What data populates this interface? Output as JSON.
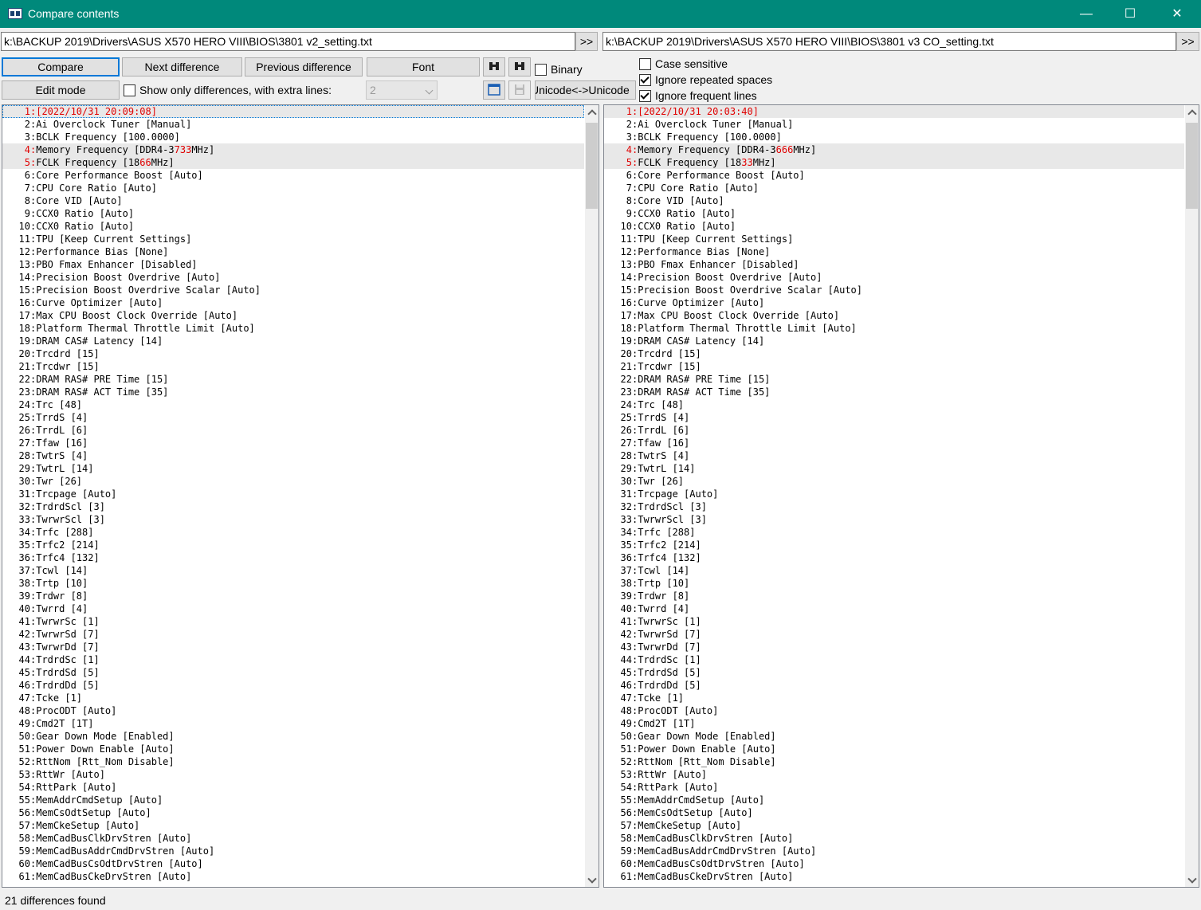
{
  "window": {
    "title": "Compare contents",
    "minimize": "—",
    "maximize": "☐",
    "close": "✕"
  },
  "left_path": "k:\\BACKUP 2019\\Drivers\\ASUS X570 HERO VIII\\BIOS\\3801 v2_setting.txt",
  "right_path": "k:\\BACKUP 2019\\Drivers\\ASUS X570 HERO VIII\\BIOS\\3801 v3 CO_setting.txt",
  "toolbar": {
    "browse_label": ">>",
    "compare": "Compare",
    "next_difference": "Next difference",
    "previous_difference": "Previous difference",
    "font": "Font",
    "binary": "Binary",
    "edit_mode": "Edit mode",
    "show_only_differences": "Show only differences, with extra lines:",
    "extra_lines_value": "2",
    "unicode": "Unicode<->Unicode",
    "case_sensitive": "Case sensitive",
    "ignore_repeated_spaces": "Ignore repeated spaces",
    "ignore_frequent_lines": "Ignore frequent lines"
  },
  "options_state": {
    "binary": false,
    "show_only_differences": false,
    "case_sensitive": false,
    "ignore_repeated_spaces": true,
    "ignore_frequent_lines": true
  },
  "icons": [
    "binoculars-icon",
    "binoculars-back-icon",
    "window-icon",
    "save-icon",
    "app-compare-icon"
  ],
  "colors": {
    "titlebar": "#00897b",
    "diff_text": "#e00000",
    "diff_row": "#e8e8e8"
  },
  "left_lines": [
    {
      "n": "1",
      "t": "[2022/10/31 20:09:08]",
      "d": true,
      "parts": [
        {
          "t": "[2022/10/31 20:",
          "h": true
        },
        {
          "t": "09",
          "h": true
        },
        {
          "t": ":08]",
          "h": true
        }
      ]
    },
    {
      "n": "2",
      "t": "Ai Overclock Tuner [Manual]"
    },
    {
      "n": "3",
      "t": "BCLK Frequency [100.0000]"
    },
    {
      "n": "4",
      "t": "Memory Frequency [DDR4-3733MHz]",
      "d": true,
      "parts": [
        {
          "t": "Memory Frequency [DDR4-3"
        },
        {
          "t": "733",
          "h": true
        },
        {
          "t": "MHz]"
        }
      ]
    },
    {
      "n": "5",
      "t": "FCLK Frequency [1866MHz]",
      "d": true,
      "parts": [
        {
          "t": "FCLK Frequency [18"
        },
        {
          "t": "66",
          "h": true
        },
        {
          "t": "MHz]"
        }
      ]
    },
    {
      "n": "6",
      "t": "Core Performance Boost [Auto]"
    },
    {
      "n": "7",
      "t": "CPU Core Ratio [Auto]"
    },
    {
      "n": "8",
      "t": "Core VID [Auto]"
    },
    {
      "n": "9",
      "t": "CCX0 Ratio [Auto]"
    },
    {
      "n": "10",
      "t": "CCX0 Ratio [Auto]"
    },
    {
      "n": "11",
      "t": "TPU [Keep Current Settings]"
    },
    {
      "n": "12",
      "t": "Performance Bias [None]"
    },
    {
      "n": "13",
      "t": "PBO Fmax Enhancer [Disabled]"
    },
    {
      "n": "14",
      "t": "Precision Boost Overdrive [Auto]"
    },
    {
      "n": "15",
      "t": "Precision Boost Overdrive Scalar [Auto]"
    },
    {
      "n": "16",
      "t": "Curve Optimizer [Auto]"
    },
    {
      "n": "17",
      "t": "Max CPU Boost Clock Override [Auto]"
    },
    {
      "n": "18",
      "t": "Platform Thermal Throttle Limit [Auto]"
    },
    {
      "n": "19",
      "t": "DRAM CAS# Latency [14]"
    },
    {
      "n": "20",
      "t": "Trcdrd [15]"
    },
    {
      "n": "21",
      "t": "Trcdwr [15]"
    },
    {
      "n": "22",
      "t": "DRAM RAS# PRE Time [15]"
    },
    {
      "n": "23",
      "t": "DRAM RAS# ACT Time [35]"
    },
    {
      "n": "24",
      "t": "Trc [48]"
    },
    {
      "n": "25",
      "t": "TrrdS [4]"
    },
    {
      "n": "26",
      "t": "TrrdL [6]"
    },
    {
      "n": "27",
      "t": "Tfaw [16]"
    },
    {
      "n": "28",
      "t": "TwtrS [4]"
    },
    {
      "n": "29",
      "t": "TwtrL [14]"
    },
    {
      "n": "30",
      "t": "Twr [26]"
    },
    {
      "n": "31",
      "t": "Trcpage [Auto]"
    },
    {
      "n": "32",
      "t": "TrdrdScl [3]"
    },
    {
      "n": "33",
      "t": "TwrwrScl [3]"
    },
    {
      "n": "34",
      "t": "Trfc [288]"
    },
    {
      "n": "35",
      "t": "Trfc2 [214]"
    },
    {
      "n": "36",
      "t": "Trfc4 [132]"
    },
    {
      "n": "37",
      "t": "Tcwl [14]"
    },
    {
      "n": "38",
      "t": "Trtp [10]"
    },
    {
      "n": "39",
      "t": "Trdwr [8]"
    },
    {
      "n": "40",
      "t": "Twrrd [4]"
    },
    {
      "n": "41",
      "t": "TwrwrSc [1]"
    },
    {
      "n": "42",
      "t": "TwrwrSd [7]"
    },
    {
      "n": "43",
      "t": "TwrwrDd [7]"
    },
    {
      "n": "44",
      "t": "TrdrdSc [1]"
    },
    {
      "n": "45",
      "t": "TrdrdSd [5]"
    },
    {
      "n": "46",
      "t": "TrdrdDd [5]"
    },
    {
      "n": "47",
      "t": "Tcke [1]"
    },
    {
      "n": "48",
      "t": "ProcODT [Auto]"
    },
    {
      "n": "49",
      "t": "Cmd2T [1T]"
    },
    {
      "n": "50",
      "t": "Gear Down Mode [Enabled]"
    },
    {
      "n": "51",
      "t": "Power Down Enable [Auto]"
    },
    {
      "n": "52",
      "t": "RttNom [Rtt_Nom Disable]"
    },
    {
      "n": "53",
      "t": "RttWr [Auto]"
    },
    {
      "n": "54",
      "t": "RttPark [Auto]"
    },
    {
      "n": "55",
      "t": "MemAddrCmdSetup [Auto]"
    },
    {
      "n": "56",
      "t": "MemCsOdtSetup [Auto]"
    },
    {
      "n": "57",
      "t": "MemCkeSetup [Auto]"
    },
    {
      "n": "58",
      "t": "MemCadBusClkDrvStren [Auto]"
    },
    {
      "n": "59",
      "t": "MemCadBusAddrCmdDrvStren [Auto]"
    },
    {
      "n": "60",
      "t": "MemCadBusCsOdtDrvStren [Auto]"
    },
    {
      "n": "61",
      "t": "MemCadBusCkeDrvStren [Auto]"
    }
  ],
  "right_lines": [
    {
      "n": "1",
      "t": "[2022/10/31 20:03:40]",
      "d": true,
      "parts": [
        {
          "t": "[2022/10/31 20:",
          "h": true
        },
        {
          "t": "03",
          "h": true
        },
        {
          "t": ":40]",
          "h": true
        }
      ]
    },
    {
      "n": "2",
      "t": "Ai Overclock Tuner [Manual]"
    },
    {
      "n": "3",
      "t": "BCLK Frequency [100.0000]"
    },
    {
      "n": "4",
      "t": "Memory Frequency [DDR4-3666MHz]",
      "d": true,
      "parts": [
        {
          "t": "Memory Frequency [DDR4-3"
        },
        {
          "t": "666",
          "h": true
        },
        {
          "t": "MHz]"
        }
      ]
    },
    {
      "n": "5",
      "t": "FCLK Frequency [1833MHz]",
      "d": true,
      "parts": [
        {
          "t": "FCLK Frequency [18"
        },
        {
          "t": "33",
          "h": true
        },
        {
          "t": "MHz]"
        }
      ]
    },
    {
      "n": "6",
      "t": "Core Performance Boost [Auto]"
    },
    {
      "n": "7",
      "t": "CPU Core Ratio [Auto]"
    },
    {
      "n": "8",
      "t": "Core VID [Auto]"
    },
    {
      "n": "9",
      "t": "CCX0 Ratio [Auto]"
    },
    {
      "n": "10",
      "t": "CCX0 Ratio [Auto]"
    },
    {
      "n": "11",
      "t": "TPU [Keep Current Settings]"
    },
    {
      "n": "12",
      "t": "Performance Bias [None]"
    },
    {
      "n": "13",
      "t": "PBO Fmax Enhancer [Disabled]"
    },
    {
      "n": "14",
      "t": "Precision Boost Overdrive [Auto]"
    },
    {
      "n": "15",
      "t": "Precision Boost Overdrive Scalar [Auto]"
    },
    {
      "n": "16",
      "t": "Curve Optimizer [Auto]"
    },
    {
      "n": "17",
      "t": "Max CPU Boost Clock Override [Auto]"
    },
    {
      "n": "18",
      "t": "Platform Thermal Throttle Limit [Auto]"
    },
    {
      "n": "19",
      "t": "DRAM CAS# Latency [14]"
    },
    {
      "n": "20",
      "t": "Trcdrd [15]"
    },
    {
      "n": "21",
      "t": "Trcdwr [15]"
    },
    {
      "n": "22",
      "t": "DRAM RAS# PRE Time [15]"
    },
    {
      "n": "23",
      "t": "DRAM RAS# ACT Time [35]"
    },
    {
      "n": "24",
      "t": "Trc [48]"
    },
    {
      "n": "25",
      "t": "TrrdS [4]"
    },
    {
      "n": "26",
      "t": "TrrdL [6]"
    },
    {
      "n": "27",
      "t": "Tfaw [16]"
    },
    {
      "n": "28",
      "t": "TwtrS [4]"
    },
    {
      "n": "29",
      "t": "TwtrL [14]"
    },
    {
      "n": "30",
      "t": "Twr [26]"
    },
    {
      "n": "31",
      "t": "Trcpage [Auto]"
    },
    {
      "n": "32",
      "t": "TrdrdScl [3]"
    },
    {
      "n": "33",
      "t": "TwrwrScl [3]"
    },
    {
      "n": "34",
      "t": "Trfc [288]"
    },
    {
      "n": "35",
      "t": "Trfc2 [214]"
    },
    {
      "n": "36",
      "t": "Trfc4 [132]"
    },
    {
      "n": "37",
      "t": "Tcwl [14]"
    },
    {
      "n": "38",
      "t": "Trtp [10]"
    },
    {
      "n": "39",
      "t": "Trdwr [8]"
    },
    {
      "n": "40",
      "t": "Twrrd [4]"
    },
    {
      "n": "41",
      "t": "TwrwrSc [1]"
    },
    {
      "n": "42",
      "t": "TwrwrSd [7]"
    },
    {
      "n": "43",
      "t": "TwrwrDd [7]"
    },
    {
      "n": "44",
      "t": "TrdrdSc [1]"
    },
    {
      "n": "45",
      "t": "TrdrdSd [5]"
    },
    {
      "n": "46",
      "t": "TrdrdDd [5]"
    },
    {
      "n": "47",
      "t": "Tcke [1]"
    },
    {
      "n": "48",
      "t": "ProcODT [Auto]"
    },
    {
      "n": "49",
      "t": "Cmd2T [1T]"
    },
    {
      "n": "50",
      "t": "Gear Down Mode [Enabled]"
    },
    {
      "n": "51",
      "t": "Power Down Enable [Auto]"
    },
    {
      "n": "52",
      "t": "RttNom [Rtt_Nom Disable]"
    },
    {
      "n": "53",
      "t": "RttWr [Auto]"
    },
    {
      "n": "54",
      "t": "RttPark [Auto]"
    },
    {
      "n": "55",
      "t": "MemAddrCmdSetup [Auto]"
    },
    {
      "n": "56",
      "t": "MemCsOdtSetup [Auto]"
    },
    {
      "n": "57",
      "t": "MemCkeSetup [Auto]"
    },
    {
      "n": "58",
      "t": "MemCadBusClkDrvStren [Auto]"
    },
    {
      "n": "59",
      "t": "MemCadBusAddrCmdDrvStren [Auto]"
    },
    {
      "n": "60",
      "t": "MemCadBusCsOdtDrvStren [Auto]"
    },
    {
      "n": "61",
      "t": "MemCadBusCkeDrvStren [Auto]"
    }
  ],
  "status": "21 differences found"
}
